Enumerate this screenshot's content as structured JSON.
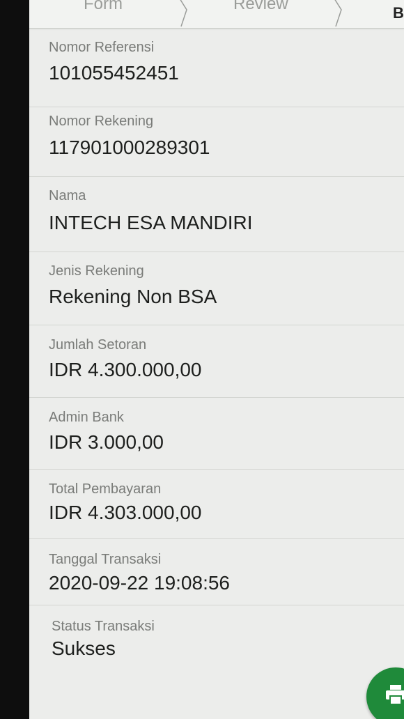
{
  "stepper": {
    "steps": [
      "Form",
      "Review",
      "B"
    ]
  },
  "fields": [
    {
      "label": "Nomor Referensi",
      "value": "101055452451"
    },
    {
      "label": "Nomor Rekening",
      "value": "117901000289301"
    },
    {
      "label": "Nama",
      "value": "INTECH ESA MANDIRI"
    },
    {
      "label": "Jenis Rekening",
      "value": "Rekening Non BSA"
    },
    {
      "label": "Jumlah Setoran",
      "value": "IDR 4.300.000,00"
    },
    {
      "label": "Admin Bank",
      "value": "IDR 3.000,00"
    },
    {
      "label": "Total Pembayaran",
      "value": "IDR 4.303.000,00"
    },
    {
      "label": "Tanggal Transaksi",
      "value": "2020-09-22 19:08:56"
    },
    {
      "label": "Status Transaksi",
      "value": "Sukses"
    }
  ],
  "fab": {
    "icon": "print-icon",
    "color": "#1f8a3a"
  }
}
